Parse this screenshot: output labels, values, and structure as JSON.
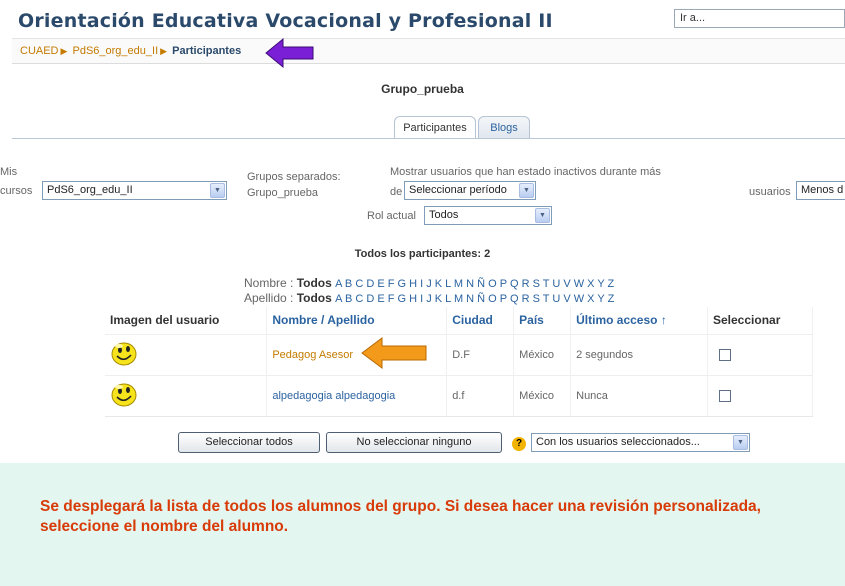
{
  "header": {
    "title": "Orientación Educativa Vocacional y Profesional II",
    "jump_value": "Ir a..."
  },
  "breadcrumb": {
    "items": [
      "CUAED",
      "PdS6_org_edu_II",
      "Participantes"
    ]
  },
  "group": {
    "name": "Grupo_prueba"
  },
  "tabs": [
    {
      "label": "Participantes"
    },
    {
      "label": "Blogs"
    }
  ],
  "filters": {
    "my_courses_label_1": "Mis",
    "my_courses_label_2": "cursos",
    "my_courses_value": "PdS6_org_edu_II",
    "groups_label": "Grupos separados:",
    "groups_value": "Grupo_prueba",
    "inactive_label": "Mostrar usuarios que han estado inactivos durante más",
    "inactive_prefix": "de",
    "period_value": "Seleccionar período",
    "users_label": "usuarios",
    "users_value": "Menos d",
    "role_label": "Rol actual",
    "role_value": "Todos"
  },
  "participants": {
    "total_label": "Todos los participantes: 2"
  },
  "alphabet": {
    "first_label": "Nombre : ",
    "last_label": "Apellido : ",
    "all": "Todos",
    "letters": "A B C D E F G H I J K L M N Ñ O P Q R S T U V W X Y Z"
  },
  "table": {
    "headers": [
      "Imagen del usuario",
      "Nombre / Apellido",
      "Ciudad",
      "País",
      "Último acceso ↑",
      "Seleccionar"
    ],
    "rows": [
      {
        "name": "Pedagog Asesor",
        "city": "D.F",
        "country": "México",
        "last_access": "2 segundos"
      },
      {
        "name": "alpedagogia alpedagogia",
        "city": "d.f",
        "country": "México",
        "last_access": "Nunca"
      }
    ]
  },
  "actions": {
    "select_all": "Seleccionar todos",
    "select_none": "No seleccionar ninguno",
    "help_symbol": "?",
    "with_selected": "Con los usuarios seleccionados..."
  },
  "note": {
    "text": "Se desplegará la lista de todos los alumnos del grupo. Si desea hacer una revisión personalizada, seleccione el nombre del alumno."
  },
  "colors": {
    "arrow_purple": "#7b1fd6",
    "arrow_orange": "#f39a1a",
    "note_bg": "#e3f7f0",
    "note_text": "#d83a08"
  },
  "icons": {
    "avatar": "smiley-icon",
    "sort": "sort-arrow-icon",
    "dropdown": "chevron-down-icon"
  }
}
